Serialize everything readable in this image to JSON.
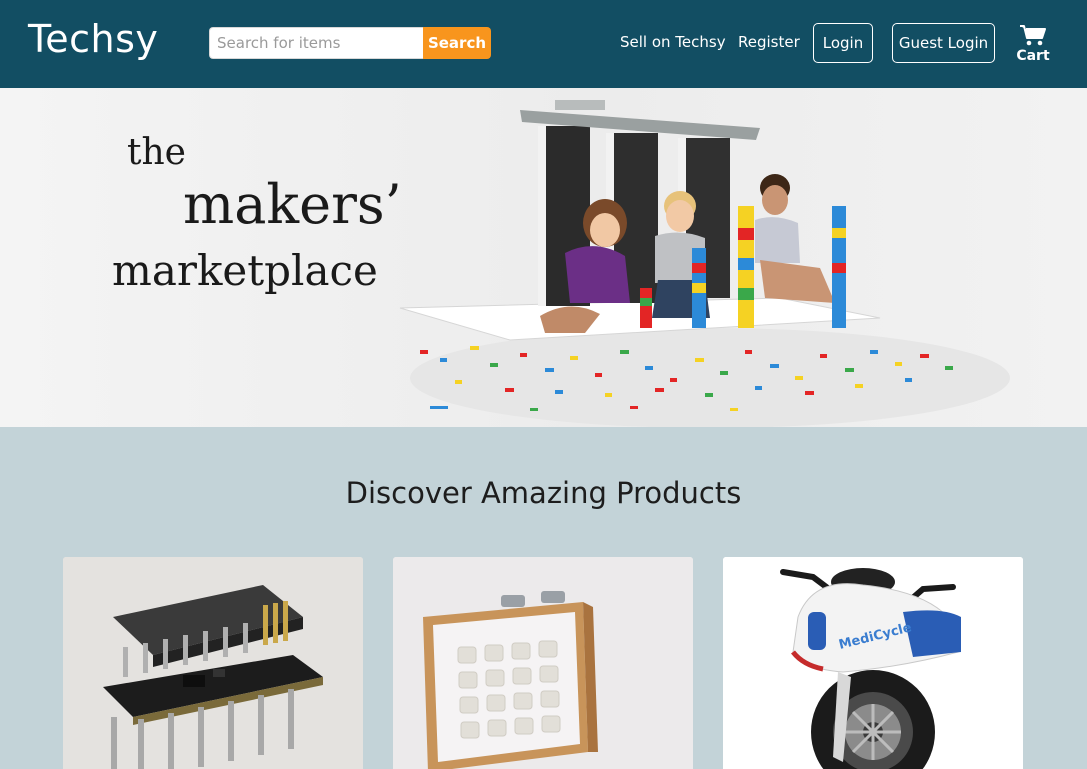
{
  "header": {
    "logo": "Techsy",
    "search": {
      "placeholder": "Search for items",
      "button_label": "Search"
    },
    "nav": {
      "sell_label": "Sell on Techsy",
      "register_label": "Register",
      "login_label": "Login",
      "guest_login_label": "Guest Login",
      "cart_label": "Cart"
    },
    "colors": {
      "navbar": "#124e63",
      "search_button": "#f8951d"
    }
  },
  "hero": {
    "line1": "the",
    "line2": "makers’",
    "line3": "marketplace"
  },
  "main": {
    "section_title": "Discover Amazing Products",
    "background": "#c3d3d8"
  },
  "icons": [
    "cart-icon"
  ]
}
